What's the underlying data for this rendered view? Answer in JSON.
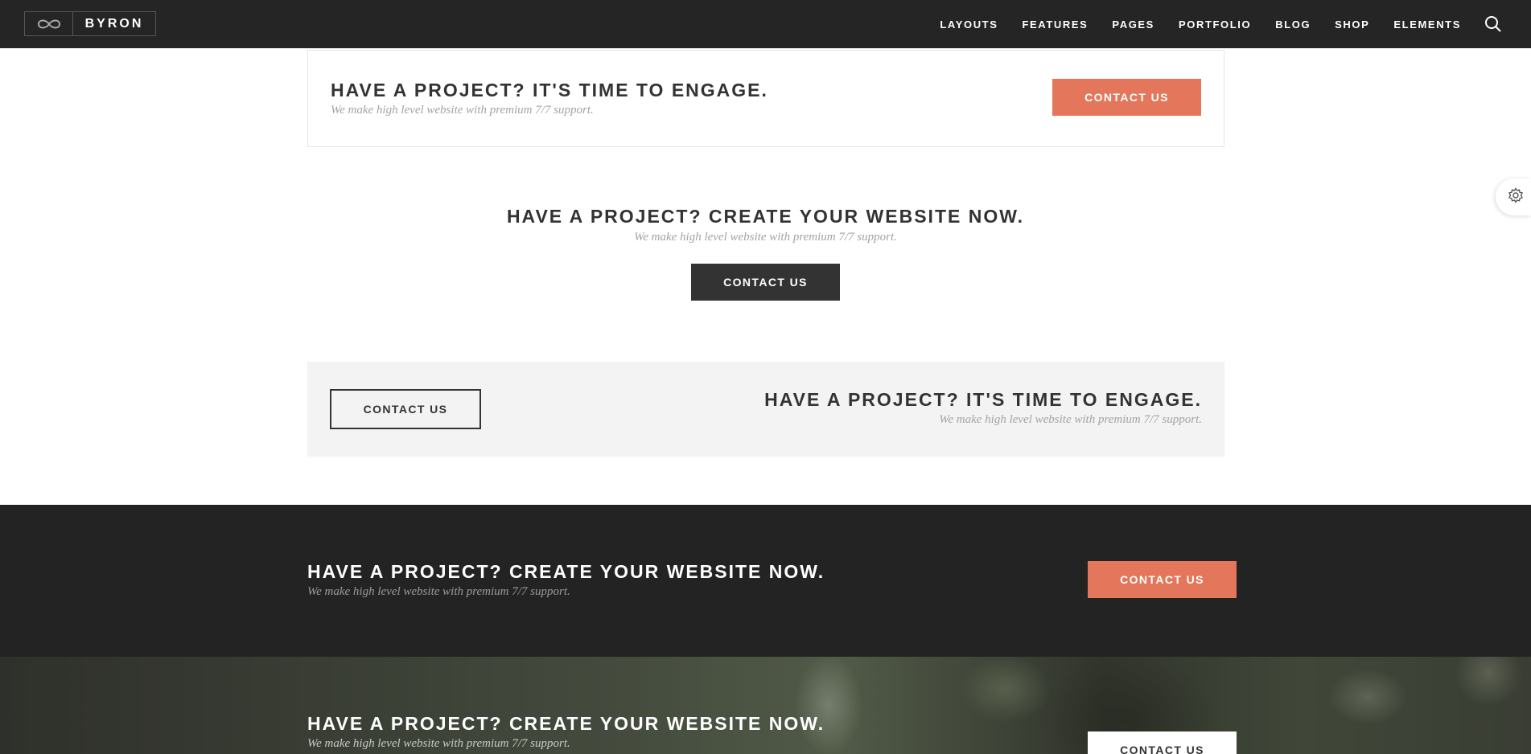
{
  "brand": {
    "name": "BYRON",
    "logo_icon": "infinity-icon"
  },
  "nav": {
    "items": [
      "LAYOUTS",
      "FEATURES",
      "PAGES",
      "PORTFOLIO",
      "BLOG",
      "SHOP",
      "ELEMENTS"
    ],
    "search_icon": "search-icon"
  },
  "settings_icon": "gear-icon",
  "colors": {
    "accent": "#e4775b",
    "dark": "#232323",
    "text": "#333333"
  },
  "sections": [
    {
      "title": "HAVE A PROJECT? IT'S TIME TO ENGAGE.",
      "subtitle": "We make high level website with premium 7/7 support.",
      "button": "CONTACT US"
    },
    {
      "title": "HAVE A PROJECT? CREATE YOUR WEBSITE NOW.",
      "subtitle": "We make high level website with premium 7/7 support.",
      "button": "CONTACT US"
    },
    {
      "title": "HAVE A PROJECT? IT'S TIME TO ENGAGE.",
      "subtitle": "We make high level website with premium 7/7 support.",
      "button": "CONTACT US"
    },
    {
      "title": "HAVE A PROJECT? CREATE YOUR WEBSITE NOW.",
      "subtitle": "We make high level website with premium 7/7 support.",
      "button": "CONTACT US"
    },
    {
      "title": "HAVE A PROJECT? CREATE YOUR WEBSITE NOW.",
      "subtitle": "We make high level website with premium 7/7 support.",
      "button": "CONTACT US"
    }
  ]
}
